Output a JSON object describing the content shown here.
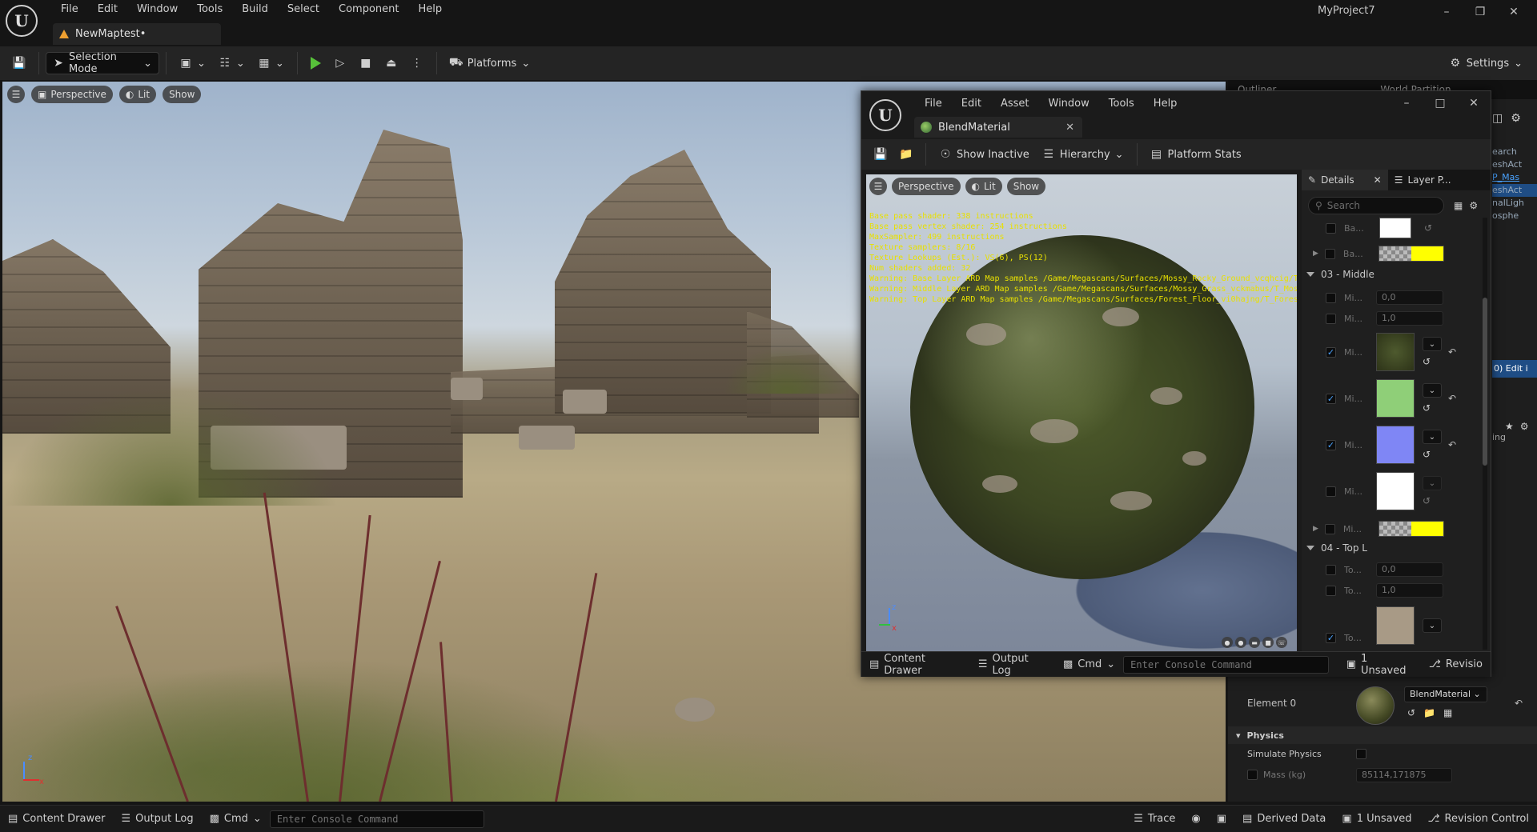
{
  "app": {
    "project_name": "MyProject7",
    "level_tab": "NewMaptest•",
    "menu": [
      "File",
      "Edit",
      "Window",
      "Tools",
      "Build",
      "Select",
      "Component",
      "Help"
    ]
  },
  "toolbar": {
    "selection_mode": "Selection Mode",
    "platforms": "Platforms",
    "settings": "Settings"
  },
  "viewport": {
    "perspective": "Perspective",
    "lit": "Lit",
    "show": "Show",
    "axis_z": "z",
    "axis_x": "x"
  },
  "right_panel": {
    "tabs": [
      "Outliner",
      "World Partition"
    ],
    "snippets": [
      "earch",
      "eshAct",
      "P_Mas",
      "eshAct",
      "nalLigh",
      "osphe",
      "0) Edit i",
      "ing"
    ],
    "element_label": "Element 0",
    "material_name": "BlendMaterial",
    "physics_header": "Physics",
    "simulate_physics": "Simulate Physics",
    "mass_label": "Mass (kg)",
    "mass_value": "85114,171875"
  },
  "status_bar": {
    "content_drawer": "Content Drawer",
    "output_log": "Output Log",
    "cmd": "Cmd",
    "console_placeholder": "Enter Console Command",
    "trace": "Trace",
    "derived_data": "Derived Data",
    "unsaved": "1 Unsaved",
    "revision_control": "Revision Control"
  },
  "material_editor": {
    "menu": [
      "File",
      "Edit",
      "Asset",
      "Window",
      "Tools",
      "Help"
    ],
    "tab_title": "BlendMaterial",
    "toolbar": {
      "show_inactive": "Show Inactive",
      "hierarchy": "Hierarchy",
      "platform_stats": "Platform Stats"
    },
    "viewport": {
      "perspective": "Perspective",
      "lit": "Lit",
      "show": "Show",
      "axis_z": "z",
      "axis_x": "x"
    },
    "stats": [
      "Base pass shader: 338 instructions",
      "Base pass vertex shader: 254 instructions",
      "MaxSampler: 499 instructions",
      "Texture samplers: 8/16",
      "Texture Lookups (Est.): VS(6), PS(12)",
      "Num shaders added: 32",
      "Warning: Base Layer ARD Map samples /Game/Megascans/Surfaces/Mossy_Rocky_Ground_vcqhcig/T_Mos",
      "Warning: Middle Layer ARD Map samples /Game/Megascans/Surfaces/Mossy_Grass_vckmabus/T_MossyG",
      "Warning: Top Layer ARD Map samples /Game/Megascans/Surfaces/Forest_Floor_vi0hajng/T_ForestFloor_vi"
    ],
    "details": {
      "tab_details": "Details",
      "tab_layer": "Layer P...",
      "search_placeholder": "Search",
      "rows_top": [
        "Ba...",
        "Ba..."
      ],
      "category_middle": "03 - Middle",
      "middle_rows": [
        {
          "label": "Mi...",
          "value": "0,0"
        },
        {
          "label": "Mi...",
          "value": "1,0"
        },
        {
          "label": "Mi..."
        },
        {
          "label": "Mi..."
        },
        {
          "label": "Mi..."
        },
        {
          "label": "Mi..."
        },
        {
          "label": "Mi..."
        }
      ],
      "category_top": "04 - Top L",
      "top_rows": [
        {
          "label": "To...",
          "value": "0,0"
        },
        {
          "label": "To...",
          "value": "1,0"
        },
        {
          "label": "To..."
        }
      ]
    },
    "status": {
      "content_drawer": "Content Drawer",
      "output_log": "Output Log",
      "cmd": "Cmd",
      "console_placeholder": "Enter Console Command",
      "unsaved": "1 Unsaved",
      "revision": "Revisio"
    }
  },
  "colors": {
    "accent": "#4aa3ff",
    "play_green": "#57c23a",
    "warning_yellow": "#e8e000",
    "swatch_green": "#8fcf78",
    "swatch_blue": "#7f86f5"
  }
}
